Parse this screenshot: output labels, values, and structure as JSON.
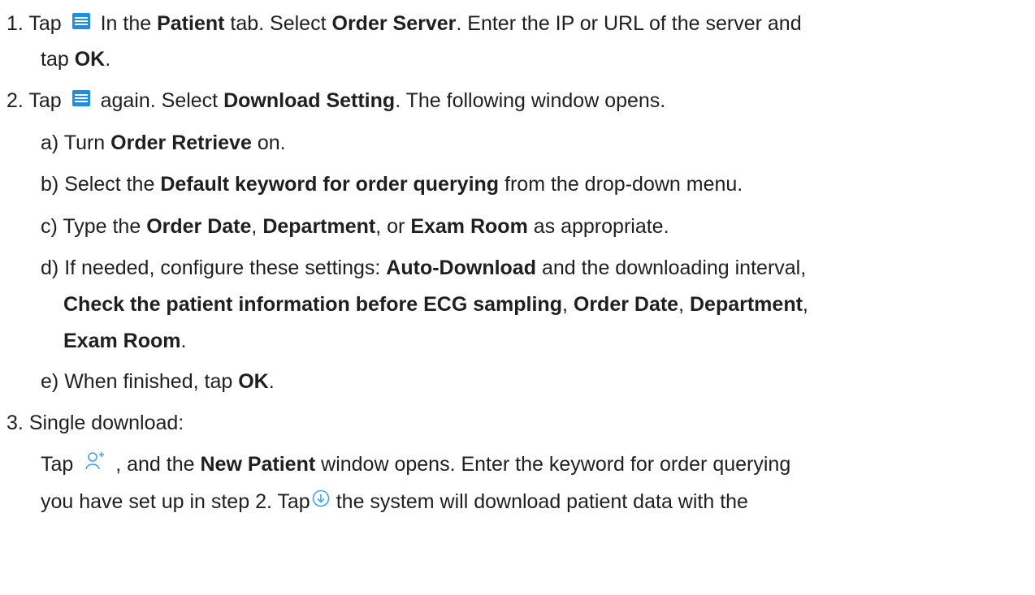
{
  "colors": {
    "text": "#1f1f1f",
    "menu_icon": "#1f8fe0",
    "line_icon": "#3ba6e8"
  },
  "icons": {
    "menu": "menu-list-icon",
    "add_patient": "add-patient-icon",
    "download": "download-circle-icon"
  },
  "step1": {
    "num": "1.",
    "a": "Tap",
    "b": "In the",
    "c": "Patient",
    "d": "tab. Select",
    "e": "Order Server",
    "f": ". Enter the IP or URL of the server and",
    "g": "tap",
    "h": "OK",
    "i": "."
  },
  "step2": {
    "num": "2.",
    "a": "Tap",
    "b": "again. Select",
    "c": "Download Setting",
    "d": ". The following window opens."
  },
  "sub_a": {
    "label": "a)",
    "a": "Turn",
    "b": "Order Retrieve",
    "c": "on."
  },
  "sub_b": {
    "label": "b)",
    "a": "Select the",
    "b": "Default keyword for order querying",
    "c": "from the drop-down menu."
  },
  "sub_c": {
    "label": "c)",
    "a": "Type the",
    "b": "Order Date",
    "c": ",",
    "d": "Department",
    "e": ", or",
    "f": "Exam Room",
    "g": "as appropriate."
  },
  "sub_d": {
    "label": "d)",
    "a": "If needed, configure these settings:",
    "b": "Auto-Download",
    "c": "and the downloading interval,",
    "d": "Check the patient information before ECG sampling",
    "e": ",",
    "f": "Order Date",
    "g": ",",
    "h": "Department",
    "i": ",",
    "j": "Exam Room",
    "k": "."
  },
  "sub_e": {
    "label": "e)",
    "a": "When finished, tap",
    "b": "OK",
    "c": "."
  },
  "step3": {
    "num": "3.",
    "a": "Single download:",
    "b": "Tap",
    "c": ", and the",
    "d": "New Patient",
    "e": "window opens. Enter the keyword for order querying",
    "f": "you have set up in step 2. Tap",
    "g": "the system will download patient data with the"
  }
}
